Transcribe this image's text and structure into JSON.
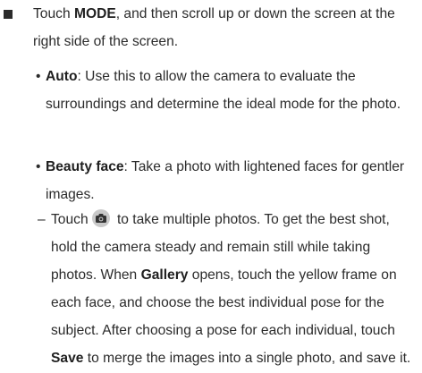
{
  "step": {
    "pre": "Touch ",
    "bold": "MODE",
    "post": ", and then scroll up or down the screen at the right side of the screen."
  },
  "auto": {
    "term": "Auto",
    "desc": ": Use this to allow the camera to evaluate the surroundings and determine the ideal mode for the photo."
  },
  "beauty": {
    "term": "Beauty face",
    "desc": ": Take a photo with lightened faces for gentler images."
  },
  "detail": {
    "a": "Touch",
    "b": " to take multiple photos. To get the best shot, hold the camera steady and remain still while taking photos. When ",
    "gallery": "Gallery",
    "c": " opens, touch the yellow frame on each face, and choose the best individual pose for the subject. After choosing a pose for each individual, touch ",
    "save": "Save",
    "d": " to merge the images into a single photo, and save it."
  },
  "icons": {
    "bullet": "square-bullet",
    "camera": "camera-icon"
  }
}
